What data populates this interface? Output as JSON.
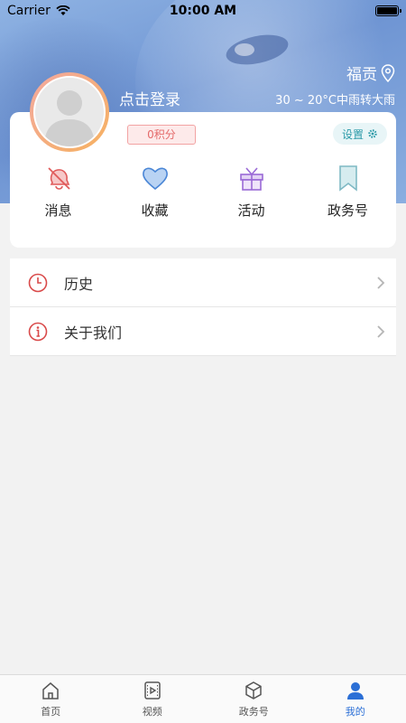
{
  "status_bar": {
    "carrier": "Carrier",
    "time": "10:00 AM"
  },
  "header": {
    "location": "福贡",
    "weather": "30 ~ 20°C中雨转大雨",
    "login_text": "点击登录"
  },
  "profile": {
    "points": "0积分",
    "settings_label": "设置"
  },
  "quick_actions": [
    {
      "label": "消息",
      "icon": "bell-off-icon"
    },
    {
      "label": "收藏",
      "icon": "heart-icon"
    },
    {
      "label": "活动",
      "icon": "gift-icon"
    },
    {
      "label": "政务号",
      "icon": "bookmark-icon"
    }
  ],
  "menu": [
    {
      "label": "历史",
      "icon": "clock-icon"
    },
    {
      "label": "关于我们",
      "icon": "info-icon"
    }
  ],
  "tabbar": [
    {
      "label": "首页",
      "icon": "home-icon"
    },
    {
      "label": "视频",
      "icon": "video-icon"
    },
    {
      "label": "政务号",
      "icon": "cube-icon"
    },
    {
      "label": "我的",
      "icon": "user-icon",
      "active": true
    }
  ],
  "colors": {
    "accent": "#2b6fd6",
    "points_text": "#e46a6a",
    "settings_text": "#2b9aa8"
  }
}
